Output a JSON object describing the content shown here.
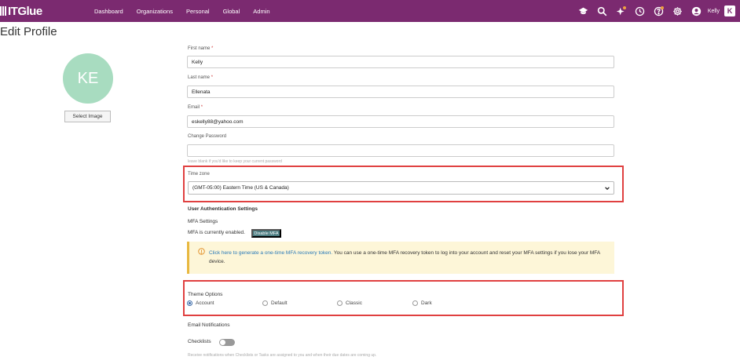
{
  "app": {
    "brand": "ITGlue",
    "nav": [
      "Dashboard",
      "Organizations",
      "Personal",
      "Global",
      "Admin"
    ],
    "user_name": "Kelly",
    "user_badge": "K",
    "icons": [
      "graduation-cap-icon",
      "search-icon",
      "sparkle-icon",
      "clock-icon",
      "help-icon",
      "gear-icon",
      "user-icon"
    ]
  },
  "page": {
    "title": "Edit Profile",
    "avatar_initials": "KE",
    "select_image_label": "Select Image"
  },
  "form": {
    "first_name_label": "First name",
    "first_name_value": "Kelly",
    "last_name_label": "Last name",
    "last_name_value": "Ellenata",
    "email_label": "Email",
    "email_value": "eskelly88@yahoo.com",
    "required_mark": "*",
    "change_password_label": "Change Password",
    "change_password_value": "",
    "password_hint": "leave blank if you'd like to keep your current password",
    "time_zone_label": "Time zone",
    "time_zone_value": "(GMT-05:00) Eastern Time (US & Canada)"
  },
  "auth": {
    "section_title": "User Authentication Settings",
    "mfa_settings_label": "MFA Settings",
    "mfa_status": "MFA is currently enabled.",
    "disable_mfa_label": "Disable MFA",
    "alert_link": "Click here to generate a one-time MFA recovery token.",
    "alert_text": " You can use a one-time MFA recovery token to log into your account and reset your MFA settings if you lose your MFA device."
  },
  "theme": {
    "label": "Theme Options",
    "options": [
      "Account",
      "Default",
      "Classic",
      "Dark"
    ],
    "selected": "Account"
  },
  "notifications": {
    "title": "Email Notifications",
    "checklists_label": "Checklists",
    "checklists_enabled": false,
    "checklists_hint": "Receive notifications when Checklists or Tasks are assigned to you and when their due dates are coming up."
  },
  "colors": {
    "topbar": "#7b2a70",
    "highlight": "#e04040",
    "avatar": "#a8dcc0",
    "alert_bg": "#fdf6d8",
    "link": "#2a7ab8"
  }
}
